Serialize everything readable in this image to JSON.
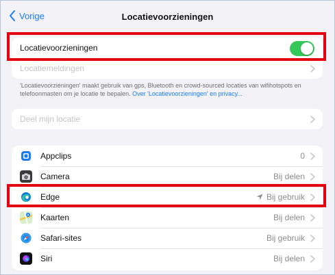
{
  "nav": {
    "back_label": "Vorige",
    "title": "Locatievoorzieningen"
  },
  "location_services": {
    "label": "Locatievoorzieningen",
    "enabled": true
  },
  "location_alerts": {
    "label": "Locatiemeldingen"
  },
  "footer": {
    "text": "'Locatievoorzieningen' maakt gebruik van gps, Bluetooth en crowd-sourced locaties van wifihotspots en telefoonmasten om je locatie te bepalen.",
    "link": "Over 'Locatievoorzieningen' en privacy..."
  },
  "share_location": {
    "label": "Deel mijn locatie"
  },
  "apps": [
    {
      "name": "Appclips",
      "value": "0",
      "icon": "appclips-icon"
    },
    {
      "name": "Camera",
      "value": "Bij delen",
      "icon": "camera-icon"
    },
    {
      "name": "Edge",
      "value": "Bij gebruik",
      "icon": "edge-icon"
    },
    {
      "name": "Kaarten",
      "value": "Bij delen",
      "icon": "maps-icon"
    },
    {
      "name": "Safari-sites",
      "value": "Bij gebruik",
      "icon": "safari-icon"
    },
    {
      "name": "Siri",
      "value": "Bij delen",
      "icon": "siri-icon"
    }
  ],
  "colors": {
    "accent": "#1a7cf5",
    "toggle_on": "#34c759",
    "highlight": "#e3000f"
  }
}
